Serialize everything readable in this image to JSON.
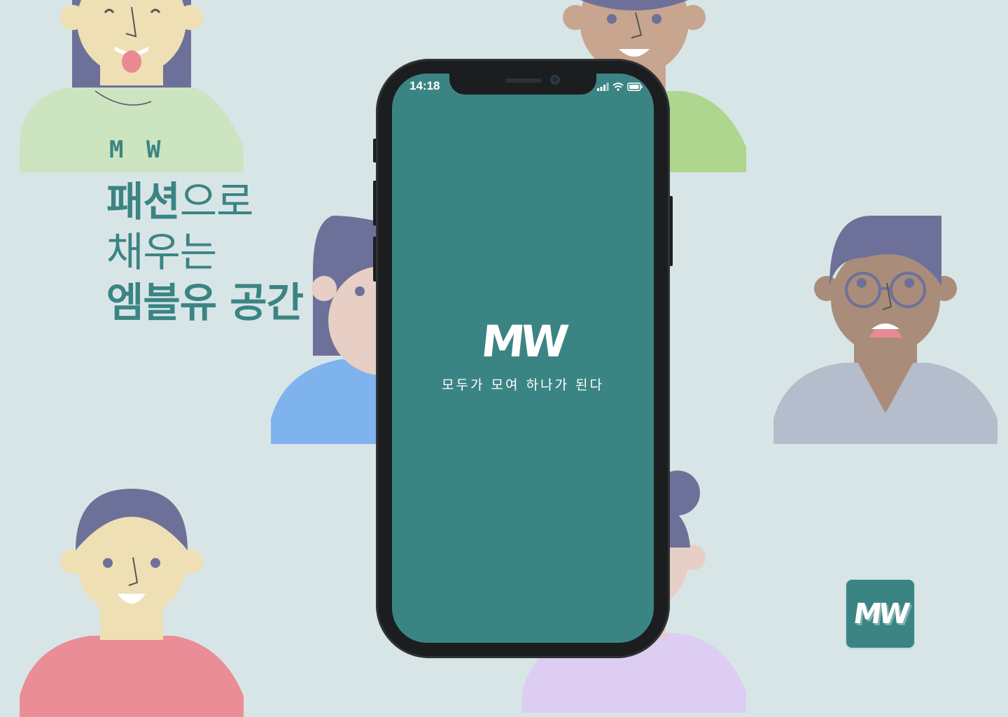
{
  "headline": {
    "line1_bold": "패션",
    "line1_light": "으로",
    "line2": "채우는",
    "line3": "엠블유 공간"
  },
  "shirt_text": "M W",
  "phone": {
    "time": "14:18",
    "logo": "MW",
    "tagline": "모두가 모여 하나가 된다"
  },
  "app_icon": {
    "label": "MW"
  },
  "icons": [
    "signal-icon",
    "wifi-icon",
    "battery-icon"
  ],
  "colors": {
    "background": "#d8e5e7",
    "brand_teal": "#3b8484",
    "hair": "#6d7199",
    "skin_light": "#efdfb4",
    "skin_medium": "#c8a58f",
    "skin_dark": "#a98c7a",
    "shirt_green_light": "#cce4c0",
    "shirt_green": "#aed68e",
    "shirt_blue": "#7eb3ed",
    "shirt_grey": "#b5bccb",
    "shirt_pink": "#ea8d96",
    "shirt_lilac": "#ddcdf2"
  }
}
